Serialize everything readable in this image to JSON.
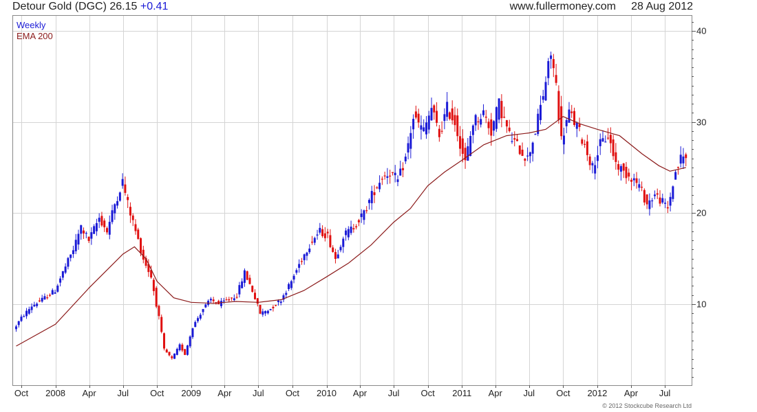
{
  "header": {
    "title": "Detour Gold (DGC) 26.15",
    "change": "+0.41",
    "site": "www.fullermoney.com",
    "date": "28 Aug 2012"
  },
  "legend": {
    "weekly": "Weekly",
    "ema": "EMA 200"
  },
  "copyright": "© 2012 Stockcube Research Ltd",
  "colors": {
    "up": "#1a1ad6",
    "down": "#e01010",
    "ema": "#8b1a1a",
    "grid": "#d4d4d4",
    "frame": "#888888"
  },
  "chart_data": {
    "type": "candlestick",
    "title": "Detour Gold (DGC) 26.15 +0.41",
    "yticks": [
      10,
      20,
      30,
      40
    ],
    "ylim": [
      1.5,
      41
    ],
    "xticks": [
      {
        "label": "Oct",
        "date": "2007-10-01"
      },
      {
        "label": "2008",
        "date": "2008-01-01"
      },
      {
        "label": "Apr",
        "date": "2008-04-01"
      },
      {
        "label": "Jul",
        "date": "2008-07-01"
      },
      {
        "label": "Oct",
        "date": "2008-10-01"
      },
      {
        "label": "2009",
        "date": "2009-01-01"
      },
      {
        "label": "Apr",
        "date": "2009-04-01"
      },
      {
        "label": "Jul",
        "date": "2009-07-01"
      },
      {
        "label": "Oct",
        "date": "2009-10-01"
      },
      {
        "label": "2010",
        "date": "2010-01-01"
      },
      {
        "label": "Apr",
        "date": "2010-04-01"
      },
      {
        "label": "Jul",
        "date": "2010-07-01"
      },
      {
        "label": "Oct",
        "date": "2010-10-01"
      },
      {
        "label": "2011",
        "date": "2011-01-01"
      },
      {
        "label": "Apr",
        "date": "2011-04-01"
      },
      {
        "label": "Jul",
        "date": "2011-07-01"
      },
      {
        "label": "Oct",
        "date": "2011-10-01"
      },
      {
        "label": "2012",
        "date": "2012-01-01"
      },
      {
        "label": "Apr",
        "date": "2012-04-01"
      },
      {
        "label": "Jul",
        "date": "2012-07-01"
      }
    ],
    "grid": true,
    "price_path": [
      [
        "2007-09-17",
        7.2
      ],
      [
        "2007-10-08",
        8.5
      ],
      [
        "2007-11-05",
        9.8
      ],
      [
        "2007-12-03",
        10.5
      ],
      [
        "2008-01-07",
        11.5
      ],
      [
        "2008-01-28",
        13.5
      ],
      [
        "2008-02-25",
        16.0
      ],
      [
        "2008-03-17",
        18.5
      ],
      [
        "2008-04-07",
        17.0
      ],
      [
        "2008-05-05",
        19.5
      ],
      [
        "2008-05-26",
        18.0
      ],
      [
        "2008-06-16",
        21.0
      ],
      [
        "2008-07-07",
        23.5
      ],
      [
        "2008-07-21",
        21.0
      ],
      [
        "2008-08-11",
        18.0
      ],
      [
        "2008-09-01",
        15.0
      ],
      [
        "2008-09-22",
        13.0
      ],
      [
        "2008-10-13",
        8.5
      ],
      [
        "2008-10-27",
        5.0
      ],
      [
        "2008-11-17",
        4.0
      ],
      [
        "2008-12-08",
        5.5
      ],
      [
        "2008-12-22",
        4.5
      ],
      [
        "2009-01-12",
        7.5
      ],
      [
        "2009-02-09",
        9.5
      ],
      [
        "2009-03-02",
        10.5
      ],
      [
        "2009-03-23",
        10.0
      ],
      [
        "2009-04-20",
        10.5
      ],
      [
        "2009-05-11",
        11.0
      ],
      [
        "2009-06-01",
        13.5
      ],
      [
        "2009-06-22",
        11.5
      ],
      [
        "2009-07-13",
        9.0
      ],
      [
        "2009-08-10",
        9.5
      ],
      [
        "2009-09-07",
        10.5
      ],
      [
        "2009-10-05",
        12.5
      ],
      [
        "2009-11-02",
        15.0
      ],
      [
        "2009-11-30",
        17.0
      ],
      [
        "2009-12-21",
        18.0
      ],
      [
        "2010-01-11",
        17.5
      ],
      [
        "2010-02-01",
        15.0
      ],
      [
        "2010-02-22",
        17.5
      ],
      [
        "2010-03-22",
        18.5
      ],
      [
        "2010-04-19",
        20.0
      ],
      [
        "2010-05-10",
        22.0
      ],
      [
        "2010-06-07",
        24.0
      ],
      [
        "2010-06-28",
        24.5
      ],
      [
        "2010-07-19",
        23.5
      ],
      [
        "2010-08-09",
        26.0
      ],
      [
        "2010-08-30",
        30.5
      ],
      [
        "2010-09-27",
        29.0
      ],
      [
        "2010-10-18",
        31.5
      ],
      [
        "2010-11-08",
        28.5
      ],
      [
        "2010-11-29",
        31.5
      ],
      [
        "2010-12-20",
        30.0
      ],
      [
        "2011-01-17",
        25.5
      ],
      [
        "2011-02-07",
        30.0
      ],
      [
        "2011-03-07",
        31.0
      ],
      [
        "2011-03-28",
        29.0
      ],
      [
        "2011-04-18",
        32.0
      ],
      [
        "2011-05-16",
        28.5
      ],
      [
        "2011-06-13",
        27.0
      ],
      [
        "2011-07-04",
        26.0
      ],
      [
        "2011-07-25",
        29.0
      ],
      [
        "2011-08-15",
        33.0
      ],
      [
        "2011-09-05",
        37.5
      ],
      [
        "2011-09-19",
        34.0
      ],
      [
        "2011-10-03",
        28.0
      ],
      [
        "2011-10-24",
        31.0
      ],
      [
        "2011-11-14",
        29.5
      ],
      [
        "2011-12-05",
        27.5
      ],
      [
        "2011-12-26",
        25.0
      ],
      [
        "2012-01-16",
        27.5
      ],
      [
        "2012-02-06",
        28.5
      ],
      [
        "2012-02-27",
        25.5
      ],
      [
        "2012-03-19",
        24.5
      ],
      [
        "2012-04-09",
        24.0
      ],
      [
        "2012-04-30",
        23.0
      ],
      [
        "2012-05-21",
        21.0
      ],
      [
        "2012-06-11",
        22.0
      ],
      [
        "2012-06-25",
        21.5
      ],
      [
        "2012-07-16",
        20.5
      ],
      [
        "2012-08-06",
        24.5
      ],
      [
        "2012-08-20",
        26.0
      ],
      [
        "2012-08-27",
        26.15
      ]
    ],
    "series": [
      {
        "name": "EMA 200",
        "points": [
          [
            "2007-09-17",
            5.4
          ],
          [
            "2008-01-01",
            7.8
          ],
          [
            "2008-04-01",
            11.8
          ],
          [
            "2008-07-01",
            15.5
          ],
          [
            "2008-08-01",
            16.3
          ],
          [
            "2008-09-01",
            15.0
          ],
          [
            "2008-10-01",
            12.5
          ],
          [
            "2008-11-15",
            10.7
          ],
          [
            "2009-01-01",
            10.2
          ],
          [
            "2009-03-01",
            10.1
          ],
          [
            "2009-05-01",
            10.3
          ],
          [
            "2009-07-01",
            10.2
          ],
          [
            "2009-09-01",
            10.5
          ],
          [
            "2009-11-01",
            11.5
          ],
          [
            "2010-01-01",
            13.0
          ],
          [
            "2010-03-01",
            14.5
          ],
          [
            "2010-05-01",
            16.5
          ],
          [
            "2010-07-01",
            19.0
          ],
          [
            "2010-08-15",
            20.5
          ],
          [
            "2010-10-01",
            23.0
          ],
          [
            "2010-11-15",
            24.5
          ],
          [
            "2011-01-01",
            25.8
          ],
          [
            "2011-03-01",
            27.5
          ],
          [
            "2011-05-01",
            28.5
          ],
          [
            "2011-07-01",
            28.8
          ],
          [
            "2011-08-15",
            29.2
          ],
          [
            "2011-10-01",
            30.6
          ],
          [
            "2011-11-15",
            29.8
          ],
          [
            "2012-01-01",
            29.2
          ],
          [
            "2012-03-01",
            28.5
          ],
          [
            "2012-05-01",
            26.5
          ],
          [
            "2012-06-15",
            25.2
          ],
          [
            "2012-07-15",
            24.6
          ],
          [
            "2012-08-27",
            25.0
          ]
        ]
      }
    ]
  }
}
